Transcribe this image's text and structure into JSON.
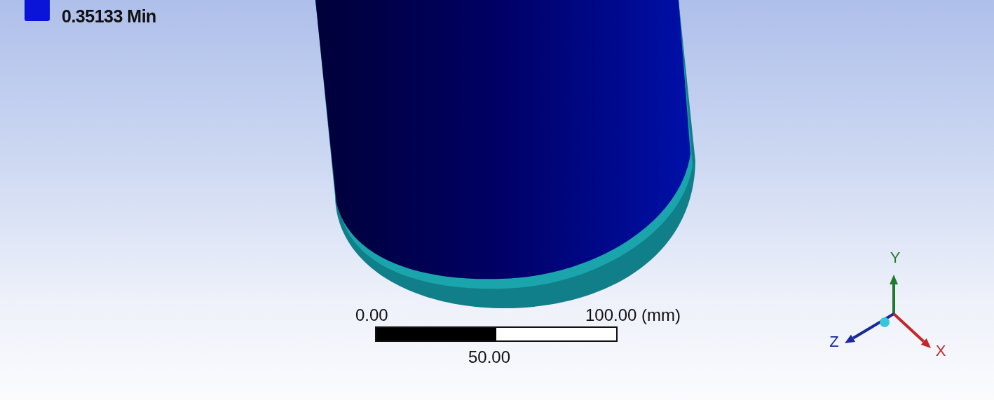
{
  "legend": {
    "min_label": "0.35133 Min"
  },
  "scale_bar": {
    "start": "0.00",
    "end": "100.00 (mm)",
    "middle": "50.00"
  },
  "triad": {
    "axes": [
      {
        "kind": "y",
        "label": "Y"
      },
      {
        "kind": "z",
        "label": "Z"
      },
      {
        "kind": "x",
        "label": "X"
      }
    ]
  }
}
